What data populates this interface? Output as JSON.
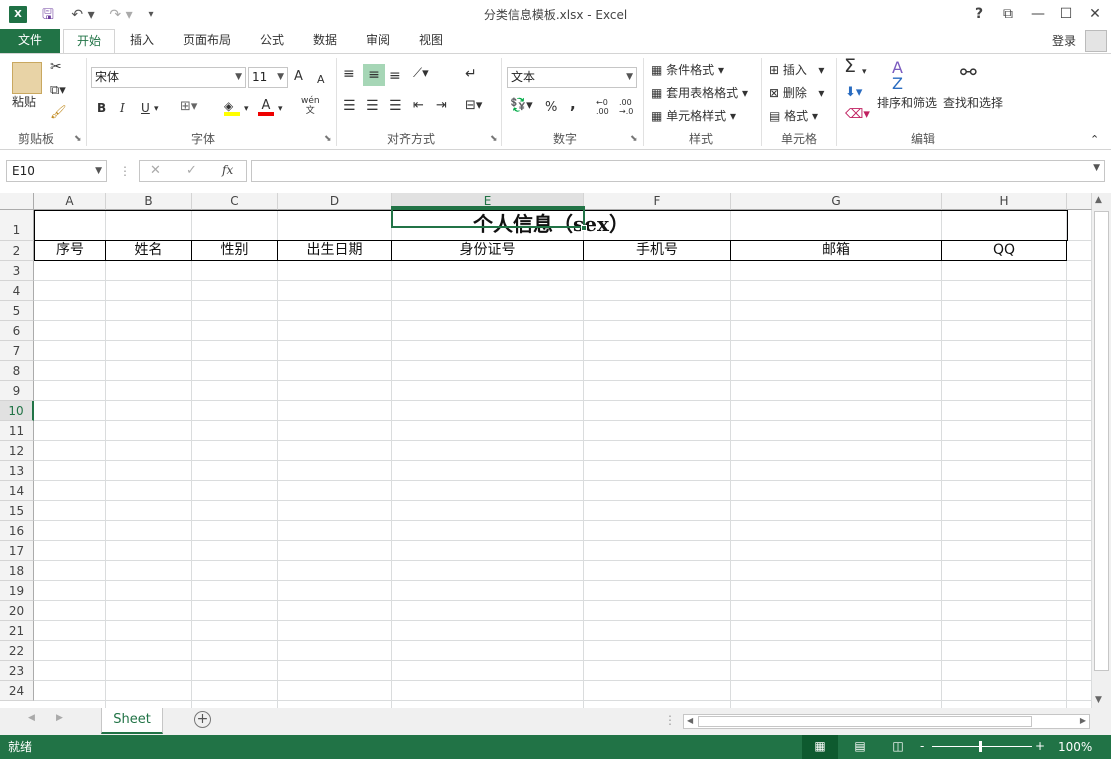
{
  "app": {
    "title": "分类信息模板.xlsx - Excel",
    "login": "登录"
  },
  "window_controls": {
    "help": "?",
    "restore_ribbon": "⧉",
    "minimize": "—",
    "maximize": "☐",
    "close": "✕"
  },
  "tabs": [
    {
      "label": "文件"
    },
    {
      "label": "开始"
    },
    {
      "label": "插入"
    },
    {
      "label": "页面布局"
    },
    {
      "label": "公式"
    },
    {
      "label": "数据"
    },
    {
      "label": "审阅"
    },
    {
      "label": "视图"
    }
  ],
  "ribbon": {
    "clipboard": {
      "paste": "粘贴",
      "label": "剪贴板"
    },
    "font": {
      "name": "宋体",
      "size": "11",
      "bold": "B",
      "italic": "I",
      "underline": "U",
      "grow": "A",
      "shrink": "A",
      "phonetic": "wén",
      "label": "字体"
    },
    "alignment": {
      "label": "对齐方式"
    },
    "number": {
      "format": "文本",
      "percent": "%",
      "comma": ",",
      "label": "数字"
    },
    "styles": {
      "conditional": "条件格式",
      "table": "套用表格格式",
      "cell_styles": "单元格样式",
      "label": "样式"
    },
    "cells": {
      "insert": "插入",
      "delete": "删除",
      "format": "格式",
      "label": "单元格"
    },
    "editing": {
      "sort": "排序和筛选",
      "find": "查找和选择",
      "label": "编辑"
    }
  },
  "formula_bar": {
    "name_box": "E10",
    "fx": "fx",
    "value": ""
  },
  "columns": [
    "A",
    "B",
    "C",
    "D",
    "E",
    "F",
    "G",
    "H"
  ],
  "rows": [
    "1",
    "2",
    "3",
    "4",
    "5",
    "6",
    "7",
    "8",
    "9",
    "10",
    "11",
    "12",
    "13",
    "14",
    "15",
    "16",
    "17",
    "18",
    "19",
    "20",
    "21",
    "22",
    "23",
    "24"
  ],
  "sheet_content": {
    "title": "个人信息（sex）",
    "headers": [
      "序号",
      "姓名",
      "性别",
      "出生日期",
      "身份证号",
      "手机号",
      "邮箱",
      "QQ"
    ]
  },
  "selected_cell": "E10",
  "sheet_tabs": [
    {
      "label": "Sheet"
    }
  ],
  "status": {
    "text": "就绪",
    "zoom": "100%",
    "zoom_minus": "-",
    "zoom_plus": "+"
  },
  "accent_color": "#217346"
}
